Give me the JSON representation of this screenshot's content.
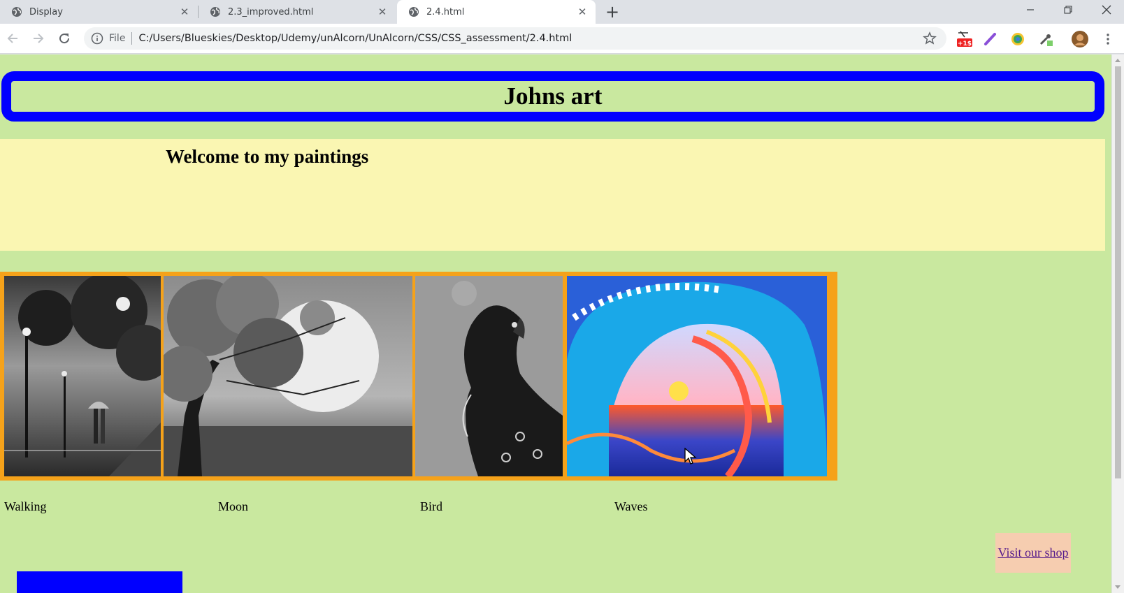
{
  "browser": {
    "tabs": [
      {
        "title": "Display",
        "active": false
      },
      {
        "title": "2.3_improved.html",
        "active": false
      },
      {
        "title": "2.4.html",
        "active": true
      }
    ],
    "new_tab_icon": "plus-icon",
    "window_controls": [
      "minimize-icon",
      "restore-icon",
      "close-icon"
    ],
    "omnibox": {
      "scheme_label": "File",
      "url": "C:/Users/Blueskies/Desktop/Udemy/unAlcorn/UnAlcorn/CSS/CSS_assessment/2.4.html"
    },
    "extension_badge": "+1$"
  },
  "page": {
    "header_title": "Johns art",
    "welcome_heading": "Welcome to my paintings",
    "paintings": [
      {
        "caption": "Walking",
        "icon": "walking-painting-image"
      },
      {
        "caption": "Moon",
        "icon": "moon-painting-image"
      },
      {
        "caption": "Bird",
        "icon": "bird-painting-image"
      },
      {
        "caption": "Waves",
        "icon": "waves-painting-image"
      }
    ],
    "shop_link": "Visit our shop"
  },
  "colors": {
    "page_background": "#c9e89f",
    "header_border": "#0000ff",
    "welcome_background": "#faf6b2",
    "gallery_border": "#f5a21a",
    "shop_background": "#f6cdb0",
    "block": "#0000ff"
  }
}
